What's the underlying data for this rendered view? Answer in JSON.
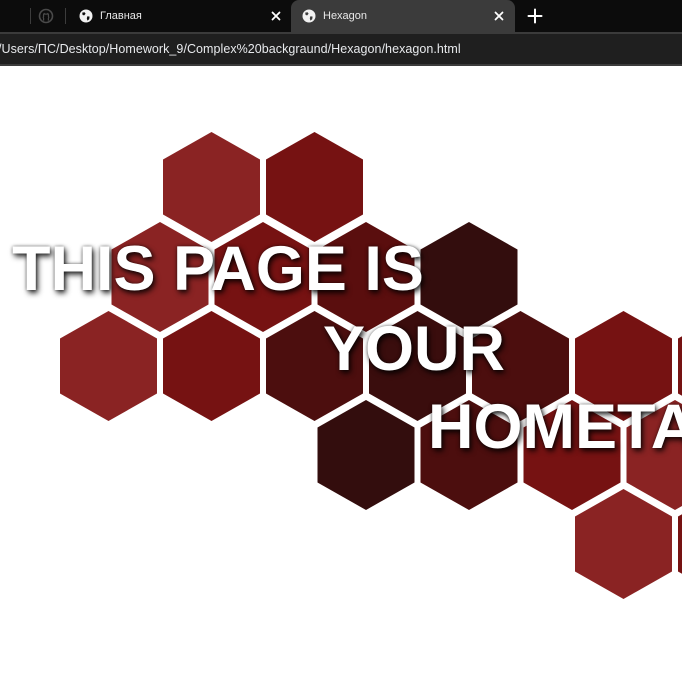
{
  "browser": {
    "tabs": [
      {
        "title": "Главная",
        "active": false
      },
      {
        "title": "Hexagon",
        "active": true
      }
    ],
    "url": "/Users/ПС/Desktop/Homework_9/Complex%20backgraund/Hexagon/hexagon.html"
  },
  "page": {
    "headline_lines": [
      "THIS PAGE IS",
      "YOUR",
      "HOMETA"
    ],
    "colors": {
      "light_red": "#8a2323",
      "red": "#761212",
      "dark_red": "#4c0e0e",
      "darkest": "#330d0d",
      "text": "#ffffff"
    }
  }
}
